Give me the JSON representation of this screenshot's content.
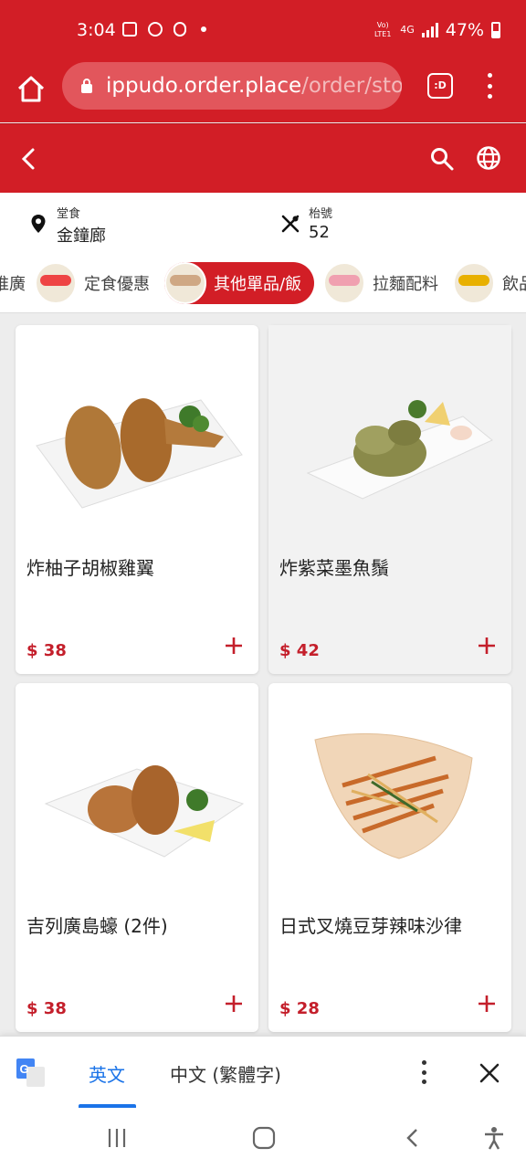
{
  "status_bar": {
    "time": "3:04",
    "network": "4G",
    "volte": "Vo) LTE1",
    "battery": "47%",
    "icons": [
      "gallery-icon",
      "app-icon",
      "app-icon",
      "dot-icon"
    ]
  },
  "browser": {
    "url_host": "ippudo.order.place",
    "url_path": "/order/sto",
    "tabs_label": ":D"
  },
  "info": {
    "mode_label": "堂食",
    "location": "金鐘廊",
    "table_label": "枱號",
    "table_number": "52"
  },
  "categories": [
    {
      "label": "推廣"
    },
    {
      "label": "定食優惠"
    },
    {
      "label": "其他單品/飯",
      "active": true
    },
    {
      "label": "拉麵配料"
    },
    {
      "label": "飲品"
    }
  ],
  "items": [
    {
      "name": "炸柚子胡椒雞翼",
      "price": "$ 38"
    },
    {
      "name": "炸紫菜墨魚鬚",
      "price": "$ 42"
    },
    {
      "name": "吉列廣島蠔 (2件)",
      "price": "$ 38"
    },
    {
      "name": "日式叉燒豆芽辣味沙律",
      "price": "$ 28"
    }
  ],
  "translate": {
    "lang_source": "英文",
    "lang_target": "中文 (繁體字)"
  },
  "colors": {
    "brand_red": "#d21e26",
    "price_red": "#c41f2b",
    "translate_blue": "#1a73e8"
  }
}
